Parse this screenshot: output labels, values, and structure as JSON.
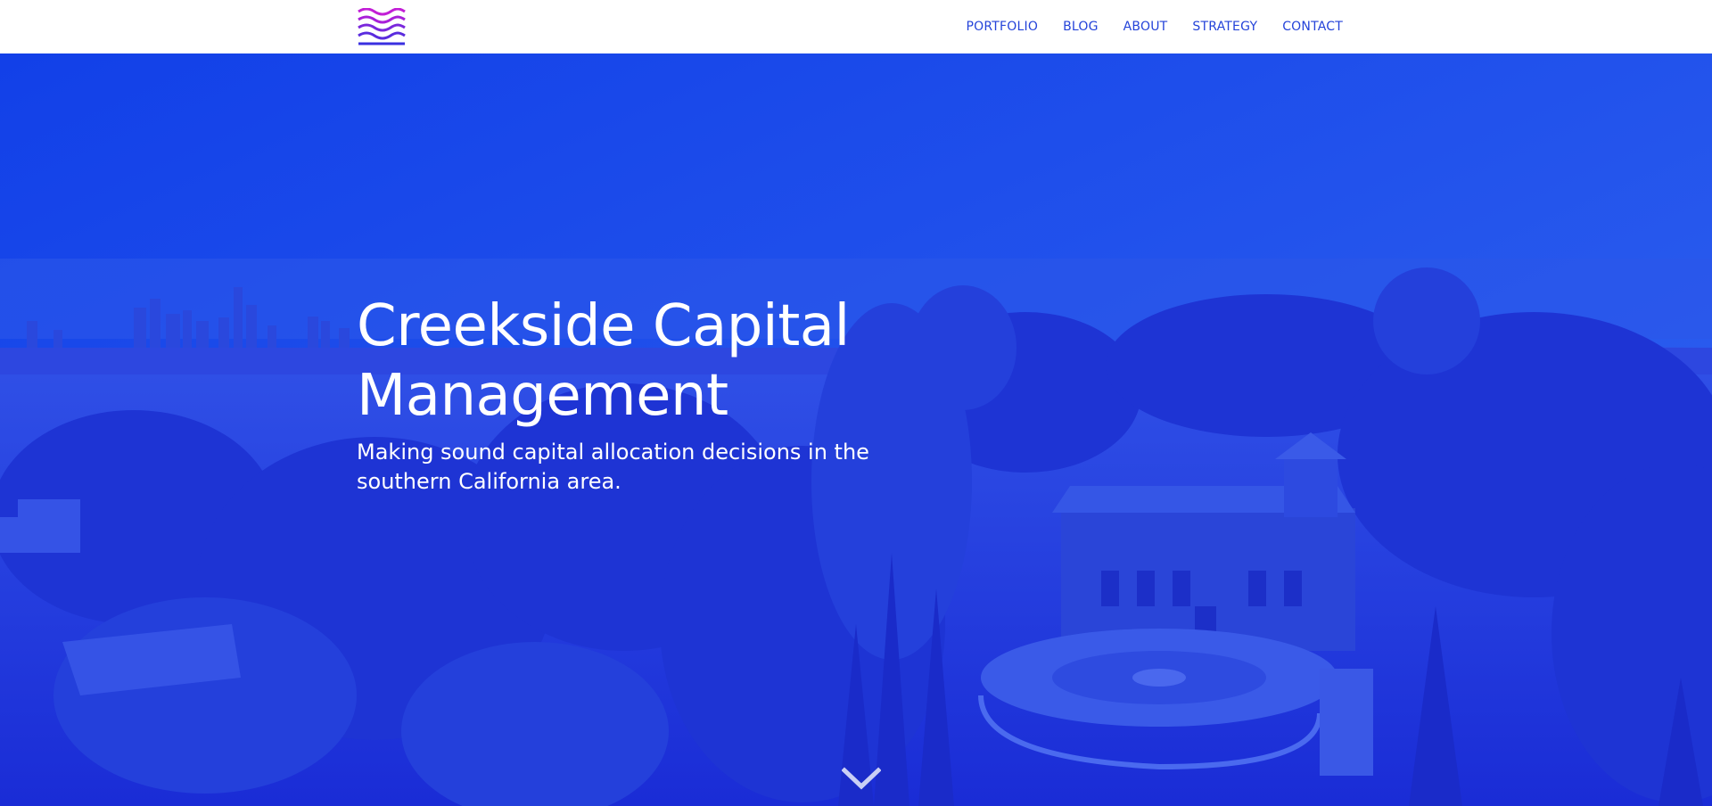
{
  "header": {
    "logo_icon": "waves-logo-icon",
    "nav": [
      {
        "label": "PORTFOLIO"
      },
      {
        "label": "BLOG"
      },
      {
        "label": "ABOUT"
      },
      {
        "label": "STRATEGY"
      },
      {
        "label": "CONTACT"
      }
    ]
  },
  "hero": {
    "title": "Creekside Capital Management",
    "subtitle": "Making sound capital allocation decisions in the southern California area.",
    "scroll_icon": "chevron-down-icon"
  },
  "colors": {
    "brand_blue": "#2443d9",
    "hero_overlay": "#1535e6",
    "logo_magenta": "#c21ed6",
    "logo_blue": "#3a2fe0"
  }
}
